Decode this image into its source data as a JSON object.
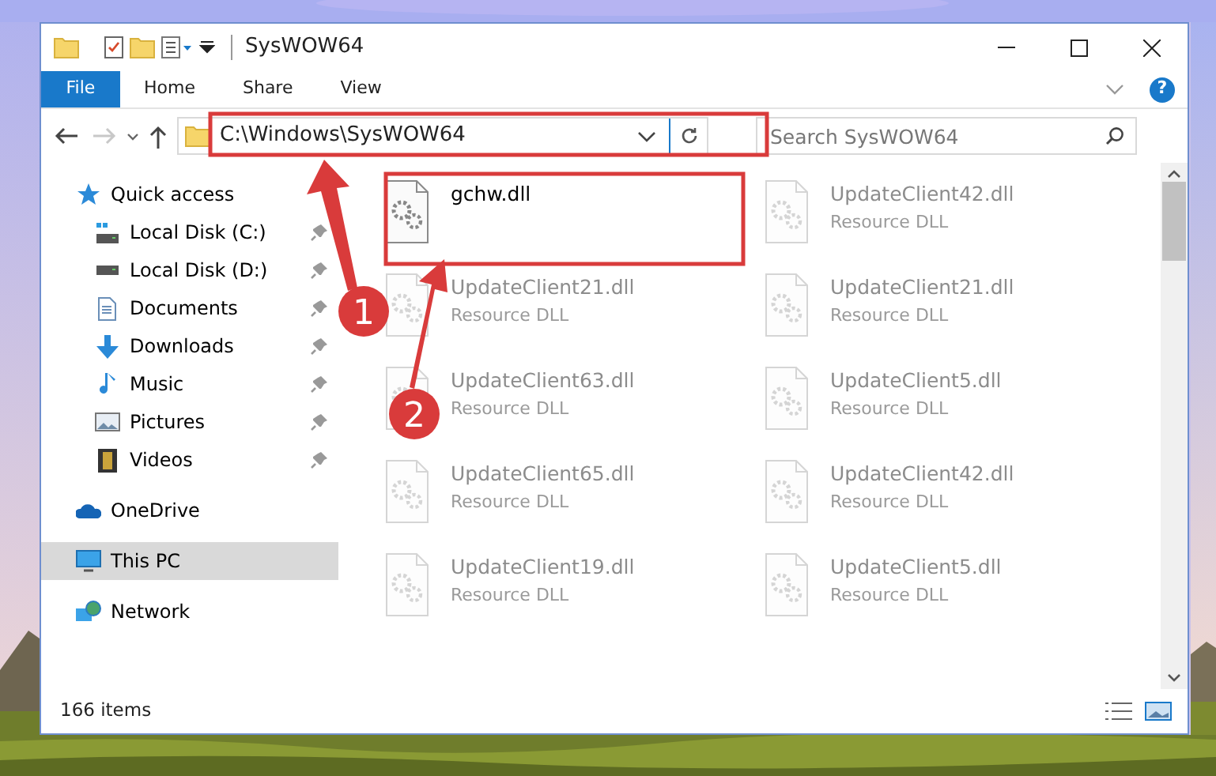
{
  "window": {
    "title": "SysWOW64"
  },
  "ribbon_tabs": [
    {
      "label": "File",
      "kind": "file"
    },
    {
      "label": "Home",
      "kind": "tab"
    },
    {
      "label": "Share",
      "kind": "tab"
    },
    {
      "label": "View",
      "kind": "tab"
    }
  ],
  "help_glyph": "?",
  "nav": {
    "forward_disabled": true
  },
  "address": {
    "path": "C:\\Windows\\SysWOW64"
  },
  "search": {
    "placeholder": "Search SysWOW64"
  },
  "sidebar": [
    {
      "label": "Quick access",
      "kind": "star",
      "selected": false,
      "children": [
        {
          "label": "Local Disk (C:)",
          "kind": "system-drive",
          "pinned": true
        },
        {
          "label": "Local Disk (D:)",
          "kind": "drive",
          "pinned": true
        },
        {
          "label": "Documents",
          "kind": "document",
          "pinned": true
        },
        {
          "label": "Downloads",
          "kind": "download",
          "pinned": true
        },
        {
          "label": "Music",
          "kind": "music",
          "pinned": true
        },
        {
          "label": "Pictures",
          "kind": "pictures",
          "pinned": true
        },
        {
          "label": "Videos",
          "kind": "videos",
          "pinned": true
        }
      ]
    },
    {
      "label": "OneDrive",
      "kind": "cloud",
      "selected": false
    },
    {
      "label": "This PC",
      "kind": "pc",
      "selected": true
    },
    {
      "label": "Network",
      "kind": "network",
      "selected": false
    }
  ],
  "files": [
    {
      "name": "gchw.dll",
      "dimmed": false
    },
    {
      "name": "UpdateClient42.dll",
      "type": "Resource DLL",
      "dimmed": true
    },
    {
      "name": "UpdateClient21.dll",
      "type": "Resource DLL",
      "dimmed": true
    },
    {
      "name": "UpdateClient21.dll",
      "type": "Resource DLL",
      "dimmed": true
    },
    {
      "name": "UpdateClient63.dll",
      "type": "Resource DLL",
      "dimmed": true
    },
    {
      "name": "UpdateClient5.dll",
      "type": "Resource DLL",
      "dimmed": true
    },
    {
      "name": "UpdateClient65.dll",
      "type": "Resource DLL",
      "dimmed": true
    },
    {
      "name": "UpdateClient42.dll",
      "type": "Resource DLL",
      "dimmed": true
    },
    {
      "name": "UpdateClient19.dll",
      "type": "Resource DLL",
      "dimmed": true
    },
    {
      "name": "UpdateClient5.dll",
      "type": "Resource DLL",
      "dimmed": true
    }
  ],
  "status_bar": {
    "count": "166 items"
  },
  "annotations": [
    {
      "label": "1"
    },
    {
      "label": "2"
    }
  ]
}
